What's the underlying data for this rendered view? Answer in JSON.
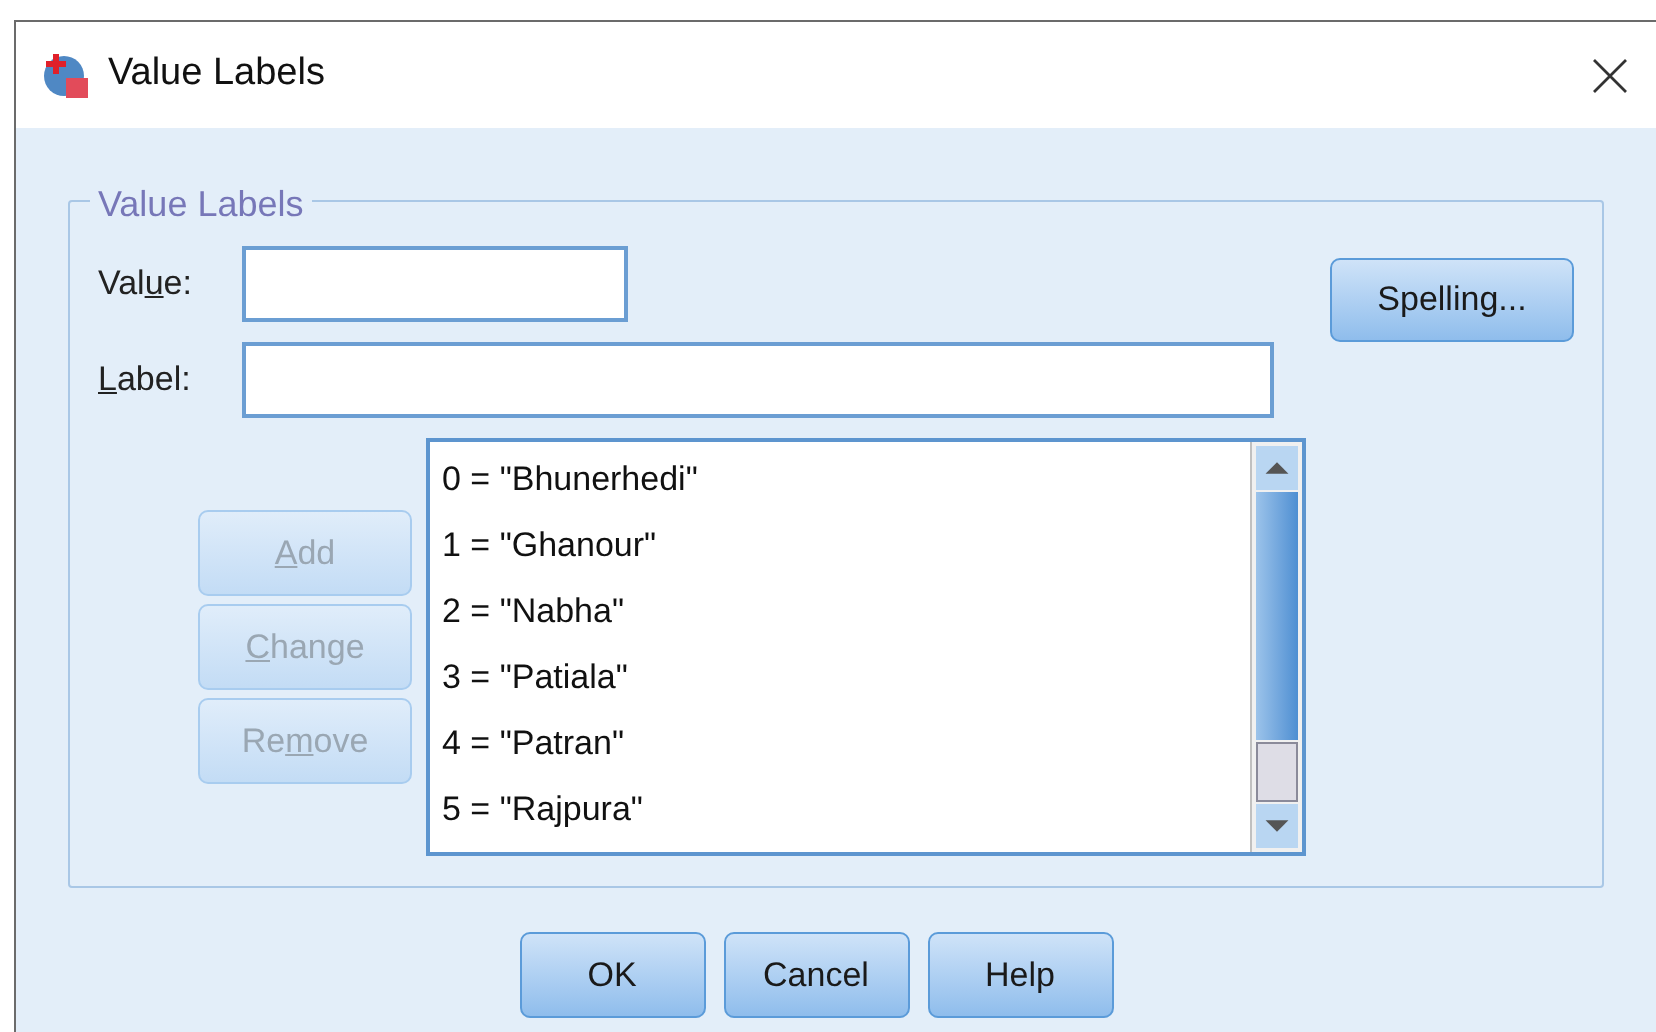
{
  "window": {
    "title": "Value Labels"
  },
  "group": {
    "title": "Value Labels"
  },
  "value_field": {
    "label": {
      "pre": "Val",
      "key": "u",
      "post": "e:"
    }
  },
  "label_field": {
    "label": {
      "key": "L",
      "post": "abel:"
    }
  },
  "spelling_button": {
    "label": "Spelling..."
  },
  "side_buttons": [
    {
      "label": {
        "key": "A",
        "post": "dd"
      },
      "disabled": true
    },
    {
      "label": {
        "key": "C",
        "post": "hange"
      },
      "disabled": true
    },
    {
      "label": {
        "pre": "Re",
        "key": "m",
        "post": "ove"
      },
      "disabled": true
    }
  ],
  "labels_list": [
    "0 = \"Bhunerhedi\"",
    "1 = \"Ghanour\"",
    "2 = \"Nabha\"",
    "3 = \"Patiala\"",
    "4 = \"Patran\"",
    "5 = \"Rajpura\""
  ],
  "buttons": [
    "OK",
    "Cancel",
    "Help"
  ]
}
